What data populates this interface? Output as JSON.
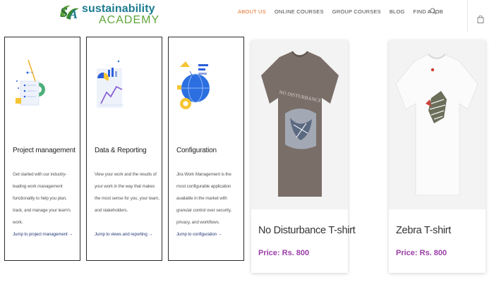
{
  "logo": {
    "line1": "sustainability",
    "line2": "ACADEMY"
  },
  "nav": {
    "items": [
      "ABOUT US",
      "ONLINE COURSES",
      "GROUP COURSES",
      "BLOG",
      "FIND A JOB"
    ],
    "active_color": "#e2712a"
  },
  "icons": {
    "search": "search-icon",
    "cart": "shopping-bag-icon"
  },
  "features": [
    {
      "title": "Project management",
      "description": "Get started with our industry-leading work management functionality to help you plan, track, and manage your team's work.",
      "link": "Jump to project management →"
    },
    {
      "title": "Data & Reporting",
      "description": "View your work and the results of your work in the way that makes the most sense for you, your team, and stakeholders.",
      "link": "Jump to views and reporting →"
    },
    {
      "title": "Configuration",
      "description": "Jira Work Management is the most configurable application available in the market with granular control over security, privacy, and workflows.",
      "link": "Jump to configuration →"
    }
  ],
  "products": [
    {
      "name": "No Disturbance T-shirt",
      "price": "Price: Rs. 800",
      "shirt_color": "#7a6e68",
      "print_text": "NO DISTURBANCE"
    },
    {
      "name": "Zebra T-shirt",
      "price": "Price: Rs. 800",
      "shirt_color": "#f7f7f7"
    }
  ],
  "colors": {
    "brand_teal": "#1c7b8f",
    "brand_green": "#5fa63a",
    "price_purple": "#9b3da6"
  }
}
